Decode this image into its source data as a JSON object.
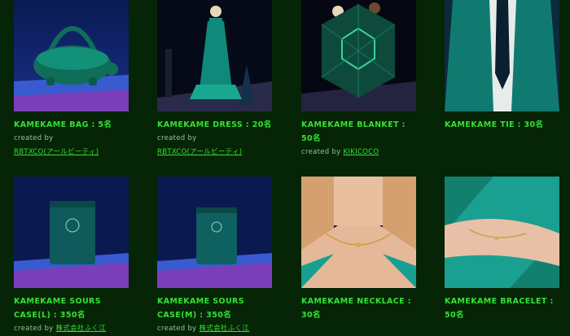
{
  "products": [
    {
      "title": "KAMEKAME BAG : 5名",
      "created_by": "created by",
      "credit": "RBTXCO(アールビーティ)",
      "image": "turtle-bag"
    },
    {
      "title": "KAMEKAME DRESS : 20名",
      "created_by": "created by",
      "credit": "RBTXCO(アールビーティ)",
      "image": "green-dress"
    },
    {
      "title": "KAMEKAME BLANKET : 50名",
      "created_by": "created by",
      "credit": "KIKICOCO",
      "image": "blanket"
    },
    {
      "title": "KAMEKAME TIE : 30名",
      "created_by": "",
      "credit": "",
      "image": "tie"
    },
    {
      "title": "KAMEKAME SOURS CASE(L) : 350名",
      "created_by": "created by",
      "credit": "株式会社ふく江",
      "image": "pouch-large"
    },
    {
      "title": "KAMEKAME SOURS CASE(M) : 350名",
      "created_by": "created by",
      "credit": "株式会社ふく江",
      "image": "pouch-medium"
    },
    {
      "title": "KAMEKAME NECKLACE : 30名",
      "created_by": "",
      "credit": "",
      "image": "necklace"
    },
    {
      "title": "KAMEKAME BRACELET : 50名",
      "created_by": "",
      "credit": "",
      "image": "bracelet"
    }
  ]
}
